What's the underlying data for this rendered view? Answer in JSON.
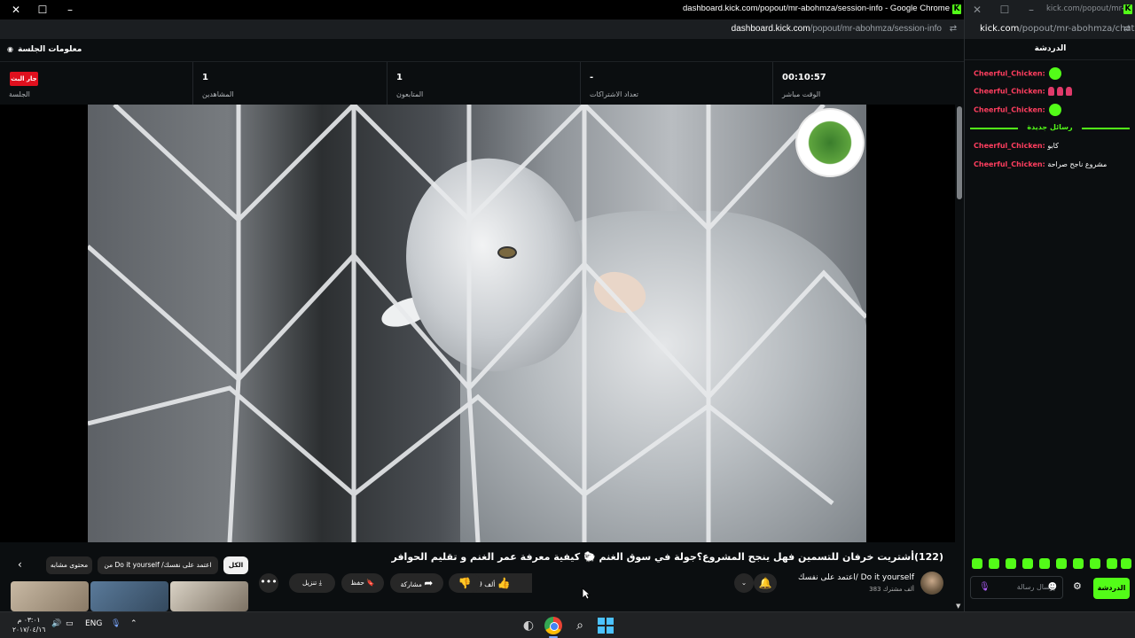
{
  "window_main": {
    "title": "dashboard.kick.com/popout/mr-abohmza/session-info - Google Chrome",
    "url_host": "dashboard.kick.com",
    "url_path": "/popout/mr-abohmza/session-info",
    "session_title": "معلومات الجلسة",
    "stats": [
      {
        "value": "",
        "label": "الجلسة"
      },
      {
        "value": "1",
        "label": "المشاهدين"
      },
      {
        "value": "1",
        "label": "المتابعون"
      },
      {
        "value": "-",
        "label": "تعداد الاشتراكات"
      },
      {
        "value": "00:10:57",
        "label": "الوقت مباشر"
      }
    ],
    "live_badge": "جار البث"
  },
  "video": {
    "title": "(122)أشتريت خرفان للتسمين فهل ينجح المشروع؟جولة في سوق الغنم 🐑 كيفية معرفة عمر الغنم و تقليم الحوافر",
    "channel_name": "اعتمد على نفسك/ Do it yourself",
    "subscribers": "383 ألف مشترك",
    "likes": "19 ألف",
    "share_label": "مشاركة",
    "save_label": "حفظ",
    "download_label": "تنزيل",
    "chips": {
      "all": "الكل",
      "from_channel": "من Do it yourself /اعتمد على نفسك",
      "related": "محتوى مشابه"
    }
  },
  "window_chat": {
    "title": "kick.com/popout/mr-...",
    "url_host": "kick.com",
    "url_path": "/popout/mr-abohmza/chat",
    "chat_title": "الدردشة",
    "messages": [
      {
        "user": "Cheerful_Chicken:",
        "text": ""
      },
      {
        "user": "Cheerful_Chicken:",
        "text": ""
      },
      {
        "user": "Cheerful_Chicken:",
        "text": ""
      },
      {
        "user": "Cheerful_Chicken:",
        "text": "كابو"
      },
      {
        "user": "Cheerful_Chicken:",
        "text": "مشروع ناجح صراحة"
      }
    ],
    "new_messages": "رسائل جديدة",
    "input_placeholder": "إرسال رسالة",
    "send_label": "الدردشة"
  },
  "taskbar": {
    "time": "٠٣:٠١ م",
    "date": "٢٠١٧/٠٤/١٦",
    "language": "ENG"
  },
  "colors": {
    "kick_green": "#53fc18",
    "live_red": "#e0101e",
    "chat_user": "#ff3e5f"
  }
}
